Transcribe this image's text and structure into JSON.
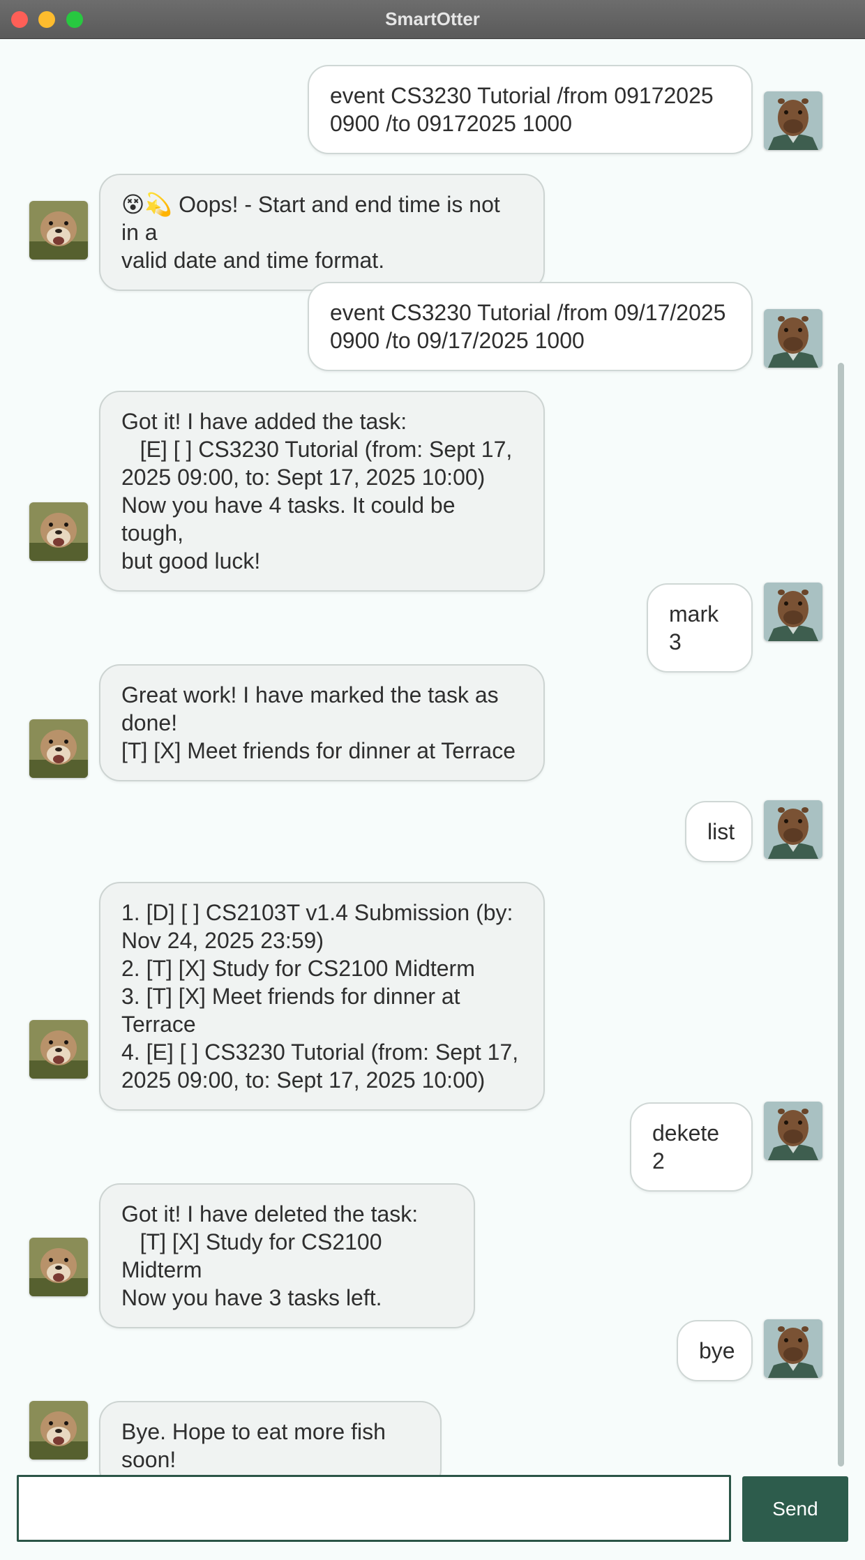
{
  "window": {
    "title": "SmartOtter"
  },
  "messages": [
    {
      "sender": "user",
      "text": "event CS3230 Tutorial /from 09172025\n0900 /to 09172025 1000"
    },
    {
      "sender": "bot",
      "text": "😵💫 Oops! - Start and end time is not in a\nvalid date and time format."
    },
    {
      "sender": "user",
      "text": "event CS3230 Tutorial /from 09/17/2025\n0900 /to 09/17/2025 1000"
    },
    {
      "sender": "bot",
      "text": "Got it! I have added the task:\n   [E] [ ] CS3230 Tutorial (from: Sept 17,\n2025 09:00, to: Sept 17, 2025 10:00)\nNow you have 4 tasks. It could be tough,\nbut good luck!"
    },
    {
      "sender": "user",
      "text": "mark 3"
    },
    {
      "sender": "bot",
      "text": "Great work! I have marked the task as\ndone!\n[T] [X] Meet friends for dinner at Terrace"
    },
    {
      "sender": "user",
      "text": "list"
    },
    {
      "sender": "bot",
      "text": "1. [D] [ ] CS2103T v1.4 Submission (by:\nNov 24, 2025 23:59)\n2. [T] [X] Study for CS2100 Midterm\n3. [T] [X] Meet friends for dinner at Terrace\n4. [E] [ ] CS3230 Tutorial (from: Sept 17,\n2025 09:00, to: Sept 17, 2025 10:00)"
    },
    {
      "sender": "user",
      "text": "dekete 2"
    },
    {
      "sender": "bot",
      "text": "Got it! I have deleted the task:\n   [T] [X] Study for CS2100 Midterm\nNow you have 3 tasks left."
    },
    {
      "sender": "user",
      "text": "bye"
    },
    {
      "sender": "bot",
      "text": "Bye. Hope to eat more fish soon!"
    }
  ],
  "input": {
    "value": "",
    "placeholder": ""
  },
  "send_button": {
    "label": "Send"
  },
  "colors": {
    "accent": "#2d5c4c",
    "background": "#f7fcfb"
  },
  "icons": {
    "user_avatar": "capybara-avatar-icon",
    "bot_avatar": "otter-avatar-icon"
  }
}
